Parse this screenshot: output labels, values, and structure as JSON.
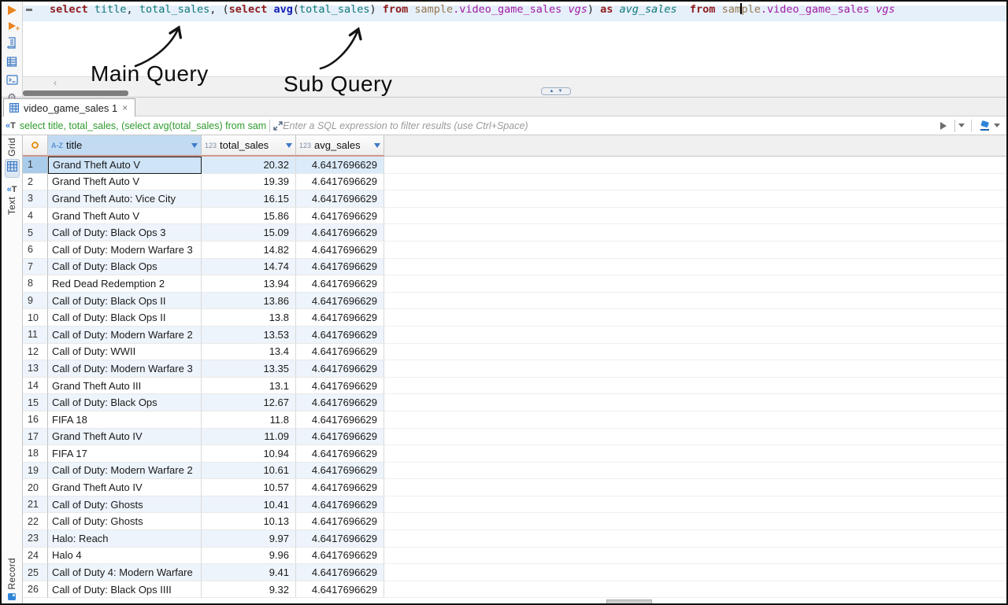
{
  "editor": {
    "tokens": [
      {
        "t": "select ",
        "c": "kw"
      },
      {
        "t": "title",
        "c": "col"
      },
      {
        "t": ", ",
        "c": "pl"
      },
      {
        "t": "total_sales",
        "c": "col"
      },
      {
        "t": ", (",
        "c": "pl"
      },
      {
        "t": "select ",
        "c": "kw"
      },
      {
        "t": "avg",
        "c": "fn"
      },
      {
        "t": "(",
        "c": "pl"
      },
      {
        "t": "total_sales",
        "c": "col"
      },
      {
        "t": ") ",
        "c": "pl"
      },
      {
        "t": "from ",
        "c": "kw"
      },
      {
        "t": "sample",
        "c": "schema"
      },
      {
        "t": ".video_game_sales",
        "c": "table"
      },
      {
        "t": " ",
        "c": "pl"
      },
      {
        "t": "vgs",
        "c": "atable"
      },
      {
        "t": ") ",
        "c": "pl"
      },
      {
        "t": "as ",
        "c": "kw"
      },
      {
        "t": "avg_sales",
        "c": "acol"
      },
      {
        "t": "  ",
        "c": "pl"
      },
      {
        "t": "from ",
        "c": "kw"
      },
      {
        "t": "sam",
        "c": "schema"
      },
      {
        "t": "",
        "c": "cursor"
      },
      {
        "t": "ple",
        "c": "schema"
      },
      {
        "t": ".video_game_sales",
        "c": "table"
      },
      {
        "t": " ",
        "c": "pl"
      },
      {
        "t": "vgs",
        "c": "atable"
      }
    ],
    "annotations": {
      "main_query": "Main Query",
      "sub_query": "Sub Query"
    }
  },
  "icons": {
    "gear": "⚙",
    "chevron_left": "‹",
    "pill_up": "▲",
    "pill_down": "▼",
    "text_filter_bracket": "«",
    "text_filter_t": "T"
  },
  "results_tab": {
    "label": "video_game_sales 1",
    "close": "×"
  },
  "filter_bar": {
    "query_preview": "select title, total_sales, (select avg(total_sales) from sam",
    "placeholder": "Enter a SQL expression to filter results (use Ctrl+Space)"
  },
  "grid": {
    "side_tabs": {
      "grid": "Grid",
      "text": "Text",
      "record": "Record"
    },
    "columns": [
      {
        "type_badge": "A-Z",
        "name": "title"
      },
      {
        "type_badge": "123",
        "name": "total_sales"
      },
      {
        "type_badge": "123",
        "name": "avg_sales"
      }
    ],
    "rows": [
      [
        "1",
        "Grand Theft Auto V",
        "20.32",
        "4.6417696629"
      ],
      [
        "2",
        "Grand Theft Auto V",
        "19.39",
        "4.6417696629"
      ],
      [
        "3",
        "Grand Theft Auto: Vice City",
        "16.15",
        "4.6417696629"
      ],
      [
        "4",
        "Grand Theft Auto V",
        "15.86",
        "4.6417696629"
      ],
      [
        "5",
        "Call of Duty: Black Ops 3",
        "15.09",
        "4.6417696629"
      ],
      [
        "6",
        "Call of Duty: Modern Warfare 3",
        "14.82",
        "4.6417696629"
      ],
      [
        "7",
        "Call of Duty: Black Ops",
        "14.74",
        "4.6417696629"
      ],
      [
        "8",
        "Red Dead Redemption 2",
        "13.94",
        "4.6417696629"
      ],
      [
        "9",
        "Call of Duty: Black Ops II",
        "13.86",
        "4.6417696629"
      ],
      [
        "10",
        "Call of Duty: Black Ops II",
        "13.8",
        "4.6417696629"
      ],
      [
        "11",
        "Call of Duty: Modern Warfare 2",
        "13.53",
        "4.6417696629"
      ],
      [
        "12",
        "Call of Duty: WWII",
        "13.4",
        "4.6417696629"
      ],
      [
        "13",
        "Call of Duty: Modern Warfare 3",
        "13.35",
        "4.6417696629"
      ],
      [
        "14",
        "Grand Theft Auto III",
        "13.1",
        "4.6417696629"
      ],
      [
        "15",
        "Call of Duty: Black Ops",
        "12.67",
        "4.6417696629"
      ],
      [
        "16",
        "FIFA 18",
        "11.8",
        "4.6417696629"
      ],
      [
        "17",
        "Grand Theft Auto IV",
        "11.09",
        "4.6417696629"
      ],
      [
        "18",
        "FIFA 17",
        "10.94",
        "4.6417696629"
      ],
      [
        "19",
        "Call of Duty: Modern Warfare 2",
        "10.61",
        "4.6417696629"
      ],
      [
        "20",
        "Grand Theft Auto IV",
        "10.57",
        "4.6417696629"
      ],
      [
        "21",
        "Call of Duty: Ghosts",
        "10.41",
        "4.6417696629"
      ],
      [
        "22",
        "Call of Duty: Ghosts",
        "10.13",
        "4.6417696629"
      ],
      [
        "23",
        "Halo: Reach",
        "9.97",
        "4.6417696629"
      ],
      [
        "24",
        "Halo 4",
        "9.96",
        "4.6417696629"
      ],
      [
        "25",
        "Call of Duty 4: Modern Warfare",
        "9.41",
        "4.6417696629"
      ],
      [
        "26",
        "Call of Duty: Black Ops IIII",
        "9.32",
        "4.6417696629"
      ]
    ]
  },
  "colors": {
    "accent_blue": "#3d78c9",
    "selected_header_bg": "#c2dbf3",
    "row_stripe": "#edf4fb",
    "header_underline": "#d0968a",
    "keyword_red": "#8f1c1c",
    "identifier_teal": "#0d7878",
    "table_purple": "#a21aa2",
    "filter_text_green": "#2f9b2f",
    "run_orange": "#e8831e"
  }
}
